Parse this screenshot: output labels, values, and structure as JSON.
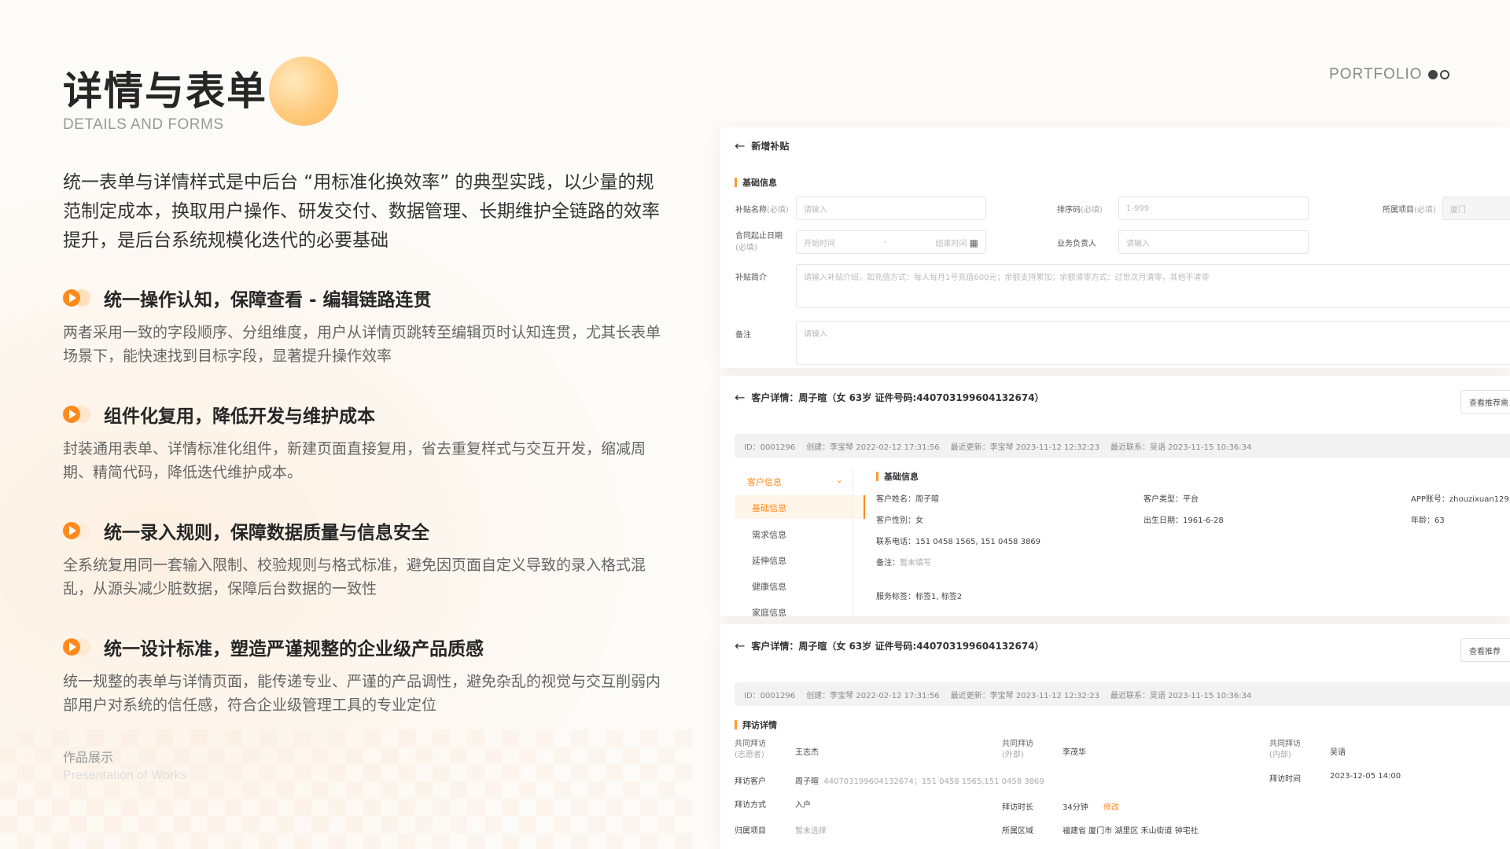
{
  "title": "详情与表单",
  "subtitle": "DETAILS AND FORMS",
  "intro": "统一表单与详情样式是中后台 “用标准化换效率” 的典型实践，以少量的规范制定成本，换取用户操作、研发交付、数据管理、长期维护全链路的效率提升，是后台系统规模化迭代的必要基础",
  "points": [
    {
      "title": "统一操作认知，保障查看 - 编辑链路连贯",
      "body": "两者采用一致的字段顺序、分组维度，用户从详情页跳转至编辑页时认知连贯，尤其长表单场景下，能快速找到目标字段，显著提升操作效率"
    },
    {
      "title": "组件化复用，降低开发与维护成本",
      "body": "封装通用表单、详情标准化组件，新建页面直接复用，省去重复样式与交互开发，缩减周期、精简代码，降低迭代维护成本。"
    },
    {
      "title": "统一录入规则，保障数据质量与信息安全",
      "body": "全系统复用同一套输入限制、校验规则与格式标准，避免因页面自定义导致的录入格式混乱，从源头减少脏数据，保障后台数据的一致性"
    },
    {
      "title": "统一设计标准，塑造严谨规整的企业级产品质感",
      "body": "统一规整的表单与详情页面，能传递专业、严谨的产品调性，避免杂乱的视觉与交互削弱内部用户对系统的信任感，符合企业级管理工具的专业定位"
    }
  ],
  "portfolio": "PORTFOLIO",
  "works_title": "作品展示",
  "works_sub": "Presentation of Works",
  "colors": {
    "accent": "#ff8a1c",
    "accent_light": "#ffd9a8"
  },
  "form_panel": {
    "header": "新增补贴",
    "section": "基础信息",
    "fields": {
      "name_label": "补贴名称",
      "name_req": "(必填)",
      "name_ph": "请输入",
      "sort_label": "排序码",
      "sort_req": "(必填)",
      "sort_ph": "1-999",
      "project_label": "所属项目",
      "project_req": "(必填)",
      "project_value": "厦门",
      "date_label": "合同起止日期",
      "date_req": "(必填)",
      "date_start_ph": "开始时间",
      "date_sep": "-",
      "date_end_ph": "结束时间",
      "owner_label": "业务负责人",
      "owner_ph": "请输入",
      "intro_label": "补贴简介",
      "intro_ph": "请输入补贴介绍，如充值方式：每人每月1号充值600元；余额支持累加；余额清零方式：过世次月清零，其他不清零",
      "remark_label": "备注",
      "remark_ph": "请输入"
    }
  },
  "detail_panel": {
    "header": "客户详情：周子暄（女 63岁 证件号码:440703199604132674）",
    "action": "查看推荐需",
    "meta": [
      "ID：0001296",
      "创建：李宝琴 2022-02-12 17:31:56",
      "最近更新：李宝琴 2023-11-12 12:32:23",
      "最近联系：吴语 2023-11-15 10:36:34"
    ],
    "side_group": "客户信息",
    "side_items": [
      "基础信息",
      "需求信息",
      "延伸信息",
      "健康信息",
      "家庭信息"
    ],
    "section": "基础信息",
    "fields": {
      "name": "客户姓名：周子暄",
      "type": "客户类型：平台",
      "app": "APP账号：zhouzixuan129",
      "gender": "客户性别：女",
      "birth": "出生日期：1961-6-28",
      "age": "年龄：63",
      "phone": "联系电话：151 0458 1565, 151 0458 3869",
      "remark_k": "备注：",
      "remark_v": "暂未填写",
      "tags": "服务标签：标签1, 标签2"
    }
  },
  "visit_panel": {
    "header": "客户详情：周子暄（女 63岁 证件号码:440703199604132674）",
    "action": "查看推荐",
    "meta": [
      "ID：0001296",
      "创建：李宝琴 2022-02-12 17:31:56",
      "最近更新：李宝琴 2023-11-12 12:32:23",
      "最近联系：吴语 2023-11-15 10:36:34"
    ],
    "section": "拜访详情",
    "fields": {
      "co1_k": "共同拜访",
      "co1_sub": "(志愿者)",
      "co1_v": "王志杰",
      "co2_k": "共同拜访",
      "co2_sub": "(外部)",
      "co2_v": "李茂华",
      "co3_k": "共同拜访",
      "co3_sub": "(内部)",
      "co3_v": "吴语",
      "cust_k": "拜访客户",
      "cust_v": "周子暄",
      "cust_extra": "440703199604132674；151 0458 1565,151 0458 3869",
      "time_k": "拜访时间",
      "time_v": "2023-12-05 14:00",
      "mode_k": "拜访方式",
      "mode_v": "入户",
      "dur_k": "拜访时长",
      "dur_v": "34分钟",
      "dur_edit": "修改",
      "proj_k": "归属项目",
      "proj_v": "暂未选择",
      "area_k": "所属区域",
      "area_v": "福建省 厦门市 湖里区 禾山街道 钟宅社"
    }
  }
}
